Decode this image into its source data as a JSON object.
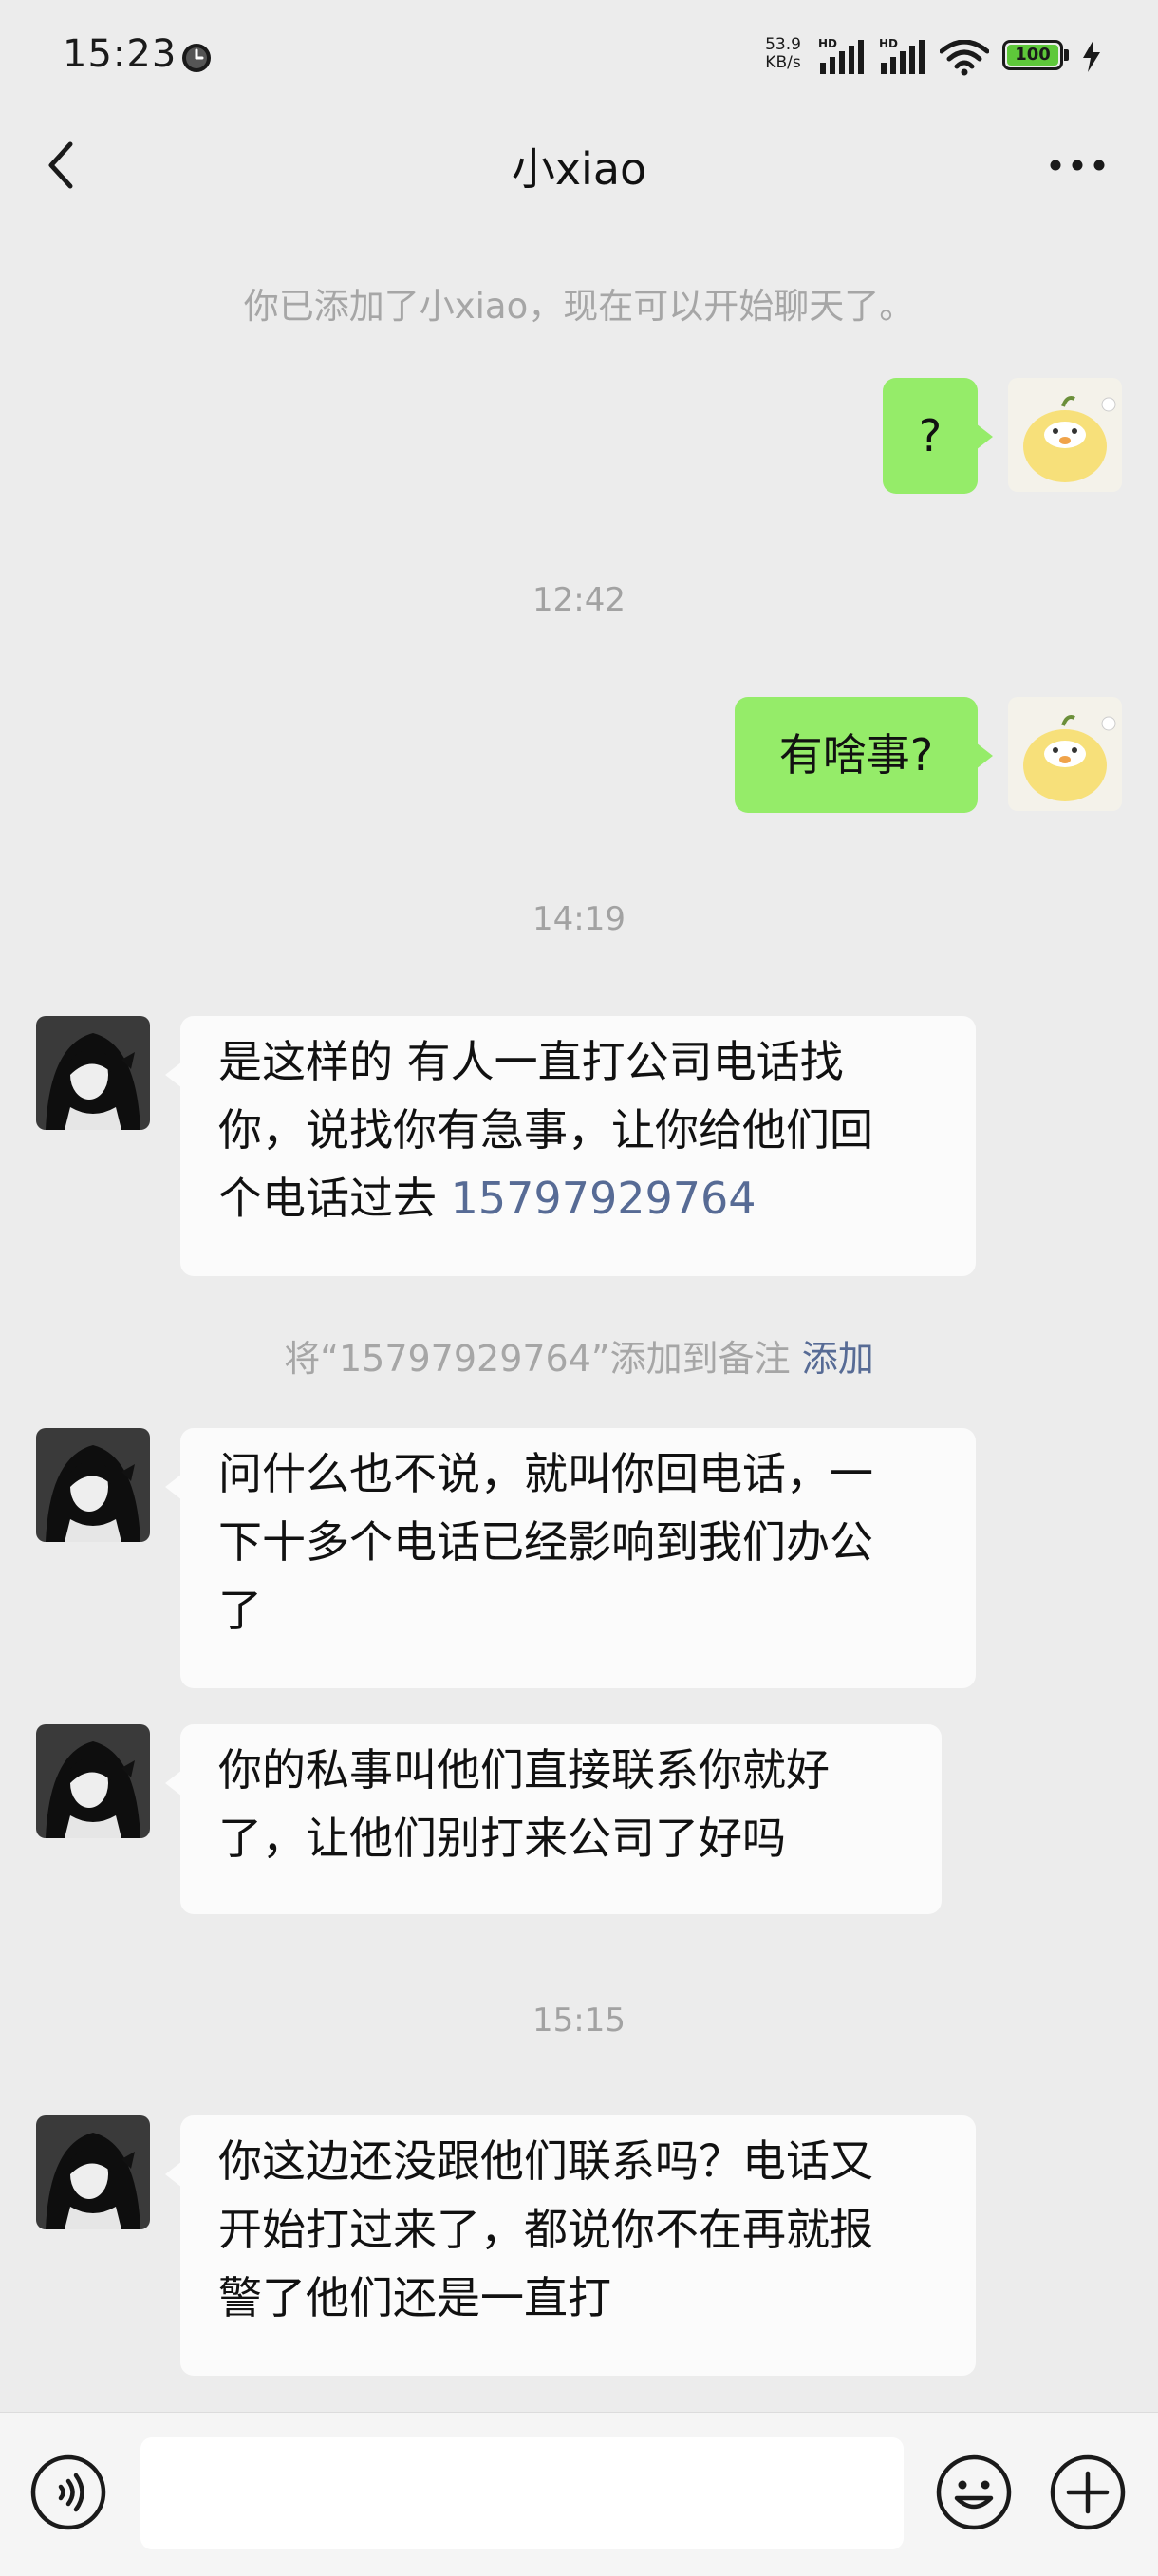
{
  "status_bar": {
    "time": "15:23",
    "net_speed_value": "53.9",
    "net_speed_unit": "KB/s",
    "signal1_label": "HD",
    "signal2_label": "HD",
    "battery_level": "100"
  },
  "header": {
    "title": "小xiao"
  },
  "chat": {
    "added_notice": "你已添加了小xiao，现在可以开始聊天了。",
    "msg1": "?",
    "time1": "12:42",
    "msg2": "有啥事?",
    "time2": "14:19",
    "msg3_line1": "是这样的 有人一直打公司电话找",
    "msg3_line2": "你，说找你有急事，让你给他们回",
    "msg3_line3_prefix": "个电话过去",
    "msg3_phone": "15797929764",
    "remark_prompt": "将“15797929764”添加到备注",
    "remark_action": "添加",
    "msg4_line1": "问什么也不说，就叫你回电话，一",
    "msg4_line2": "下十多个电话已经影响到我们办公",
    "msg4_line3": "了",
    "msg5_line1": "你的私事叫他们直接联系你就好",
    "msg5_line2": "了，让他们别打来公司了好吗",
    "time3": "15:15",
    "msg6_line1": "你这边还没跟他们联系吗？电话又",
    "msg6_line2": "开始打过来了，都说你不在再就报",
    "msg6_line3": "警了他们还是一直打"
  },
  "input_bar": {
    "placeholder": ""
  },
  "icons": {
    "back": "chevron-left-icon",
    "more": "more-dots-icon",
    "voice": "voice-icon",
    "emoji": "emoji-icon",
    "plus": "plus-icon",
    "wifi": "wifi-icon",
    "charging": "charging-icon"
  },
  "colors": {
    "background": "#ececec",
    "my_bubble": "#95ec69",
    "their_bubble": "#fbfbfb",
    "link": "#576b95"
  }
}
